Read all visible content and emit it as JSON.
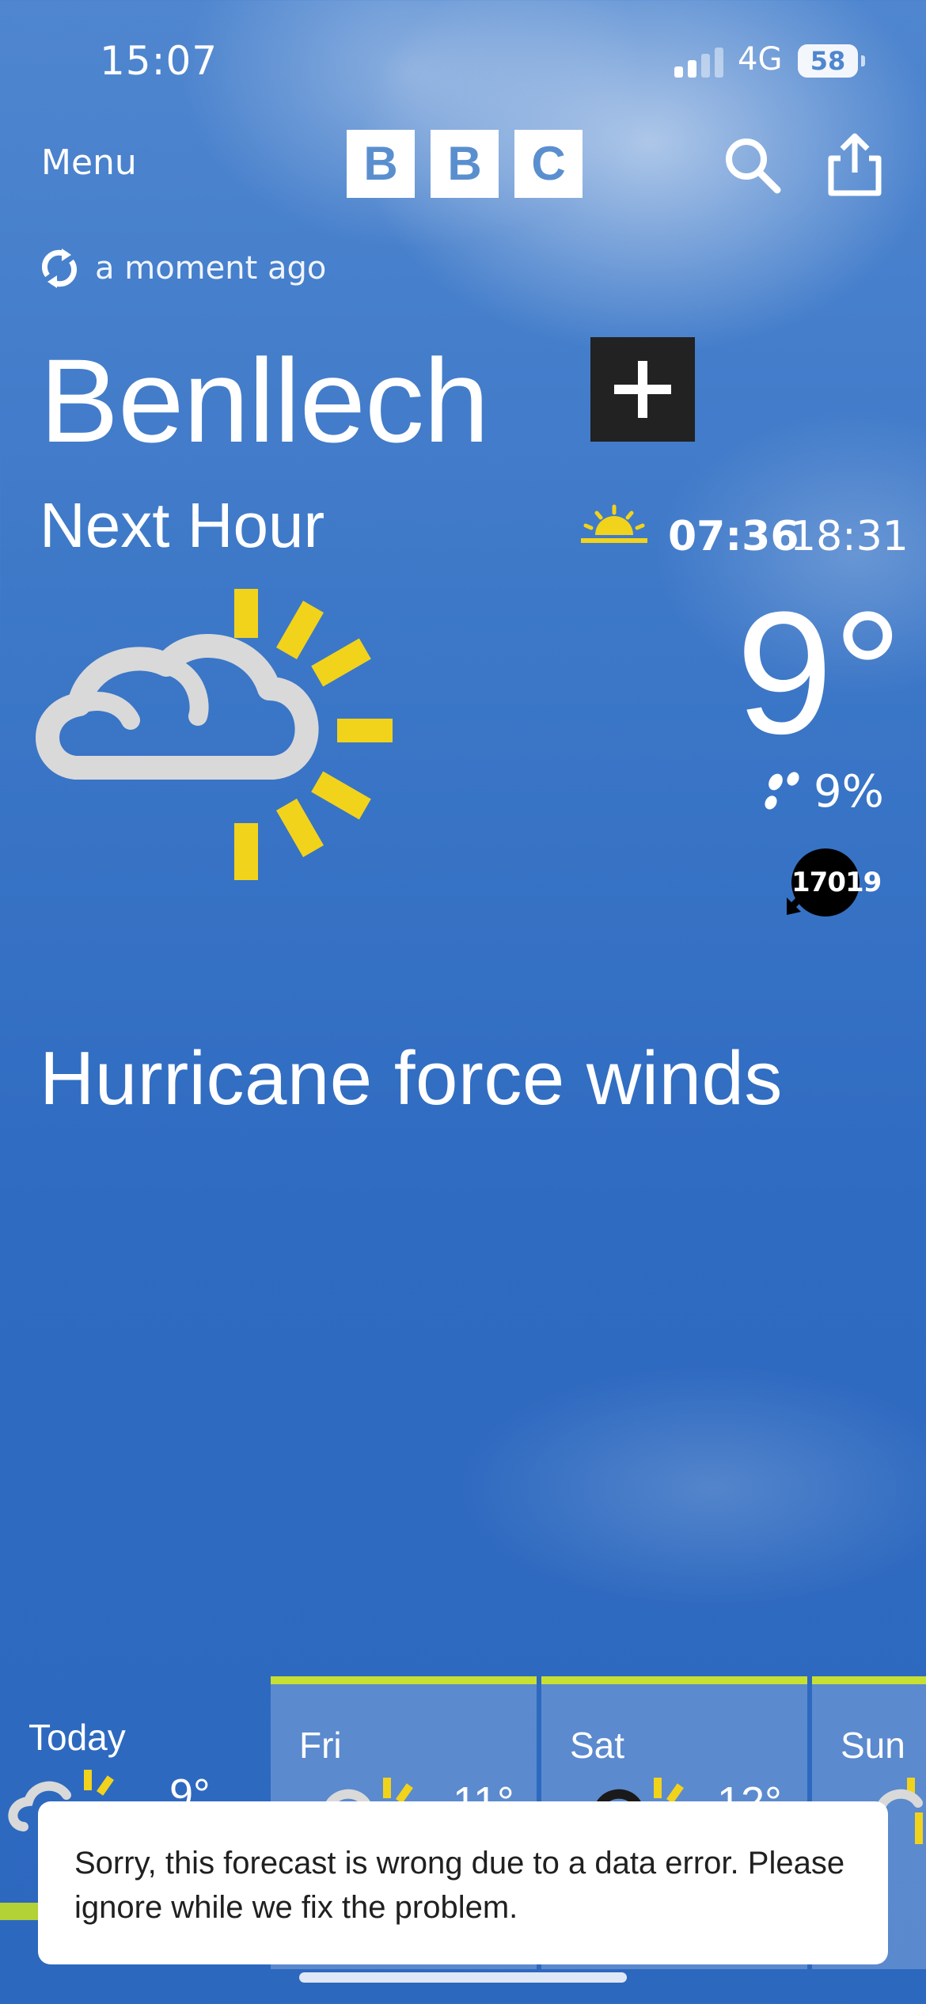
{
  "status_bar": {
    "time": "15:07",
    "network": "4G",
    "battery": "58"
  },
  "header": {
    "menu_label": "Menu",
    "logo": [
      "B",
      "B",
      "C"
    ]
  },
  "update": {
    "text": "a moment ago"
  },
  "location": {
    "name": "Benllech"
  },
  "current": {
    "period": "Next Hour",
    "sunrise": "07:36",
    "sunset": "18:31",
    "temperature": "9°",
    "precipitation": "9%",
    "wind_speed": "17019",
    "summary": "Hurricane force winds",
    "weather_icon": "sunny-intervals-icon"
  },
  "forecast": {
    "days": [
      {
        "name": "Today",
        "temp": "9°",
        "icon": "sunny-intervals-icon"
      },
      {
        "name": "Fri",
        "temp": "11°",
        "icon": "sunny-intervals-icon"
      },
      {
        "name": "Sat",
        "temp": "12°",
        "icon": "rain-sun-icon"
      },
      {
        "name": "Sun",
        "temp": "",
        "icon": "sunny-intervals-icon"
      }
    ]
  },
  "toast": {
    "message": "Sorry, this forecast is wrong due to a data error. Please ignore while we fix the problem."
  },
  "colors": {
    "sky": "#3d78c8",
    "sun": "#f2d31b",
    "accent": "#c7e032",
    "cloud": "#d9d9d9"
  }
}
